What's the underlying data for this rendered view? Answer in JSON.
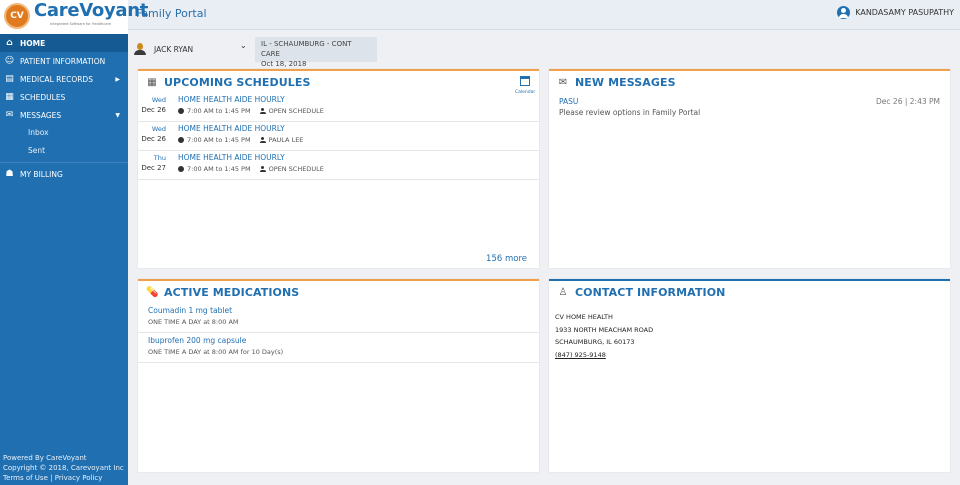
{
  "brand": {
    "logo_initials": "CV",
    "logo_name": "CareVoyant",
    "logo_tagline": "Integrated Software for Healthcare",
    "portal_title": "Family Portal",
    "accent": "#1f6fb1",
    "orange": "#f0a04b"
  },
  "user": {
    "name": "KANDASAMY PASUPATHY",
    "icon": "user-circle-icon"
  },
  "sidebar": {
    "items": [
      {
        "label": "HOME",
        "icon": "home-icon"
      },
      {
        "label": "PATIENT INFORMATION",
        "icon": "patient-icon"
      },
      {
        "label": "MEDICAL RECORDS",
        "icon": "folder-icon"
      },
      {
        "label": "SCHEDULES",
        "icon": "calendar-icon"
      },
      {
        "label": "MESSAGES",
        "icon": "envelope-icon"
      },
      {
        "label": "Inbox"
      },
      {
        "label": "Sent"
      },
      {
        "label": "MY BILLING",
        "icon": "billing-icon"
      }
    ],
    "footer": {
      "powered": "Powered By CareVoyant",
      "copyright": "Copyright © 2018, Carevoyant Inc",
      "terms": "Terms of Use",
      "separator": "|",
      "privacy": "Privacy Policy"
    }
  },
  "patient": {
    "name": "JACK RYAN",
    "location": "IL - SCHAUMBURG - CONT CARE",
    "date": "Oct 18, 2018"
  },
  "schedules": {
    "title": "UPCOMING SCHEDULES",
    "calendar_label": "Calendar",
    "more": "156 more",
    "rows": [
      {
        "day": "Wed",
        "date": "Dec 26",
        "service": "HOME HEALTH AIDE HOURLY",
        "time": "7:00 AM to 1:45 PM",
        "staff": "OPEN SCHEDULE"
      },
      {
        "day": "Wed",
        "date": "Dec 26",
        "service": "HOME HEALTH AIDE HOURLY",
        "time": "7:00 AM to 1:45 PM",
        "staff": "PAULA LEE"
      },
      {
        "day": "Thu",
        "date": "Dec 27",
        "service": "HOME HEALTH AIDE HOURLY",
        "time": "7:00 AM to 1:45 PM",
        "staff": "OPEN SCHEDULE"
      }
    ]
  },
  "messages": {
    "title": "NEW MESSAGES",
    "items": [
      {
        "from": "PASU",
        "date": "Dec 26 | 2:43 PM",
        "body": "Please review options in Family Portal"
      }
    ]
  },
  "medications": {
    "title": "ACTIVE MEDICATIONS",
    "items": [
      {
        "name": "Coumadin 1 mg tablet",
        "dose": "ONE TIME A DAY at 8:00 AM"
      },
      {
        "name": "Ibuprofen 200 mg capsule",
        "dose": "ONE TIME A DAY at 8:00 AM for 10 Day(s)"
      }
    ]
  },
  "contact": {
    "title": "CONTACT INFORMATION",
    "org": "CV HOME HEALTH",
    "street": "1933 NORTH MEACHAM ROAD",
    "city": "SCHAUMBURG, IL 60173",
    "phone": "(847) 925-9148"
  }
}
